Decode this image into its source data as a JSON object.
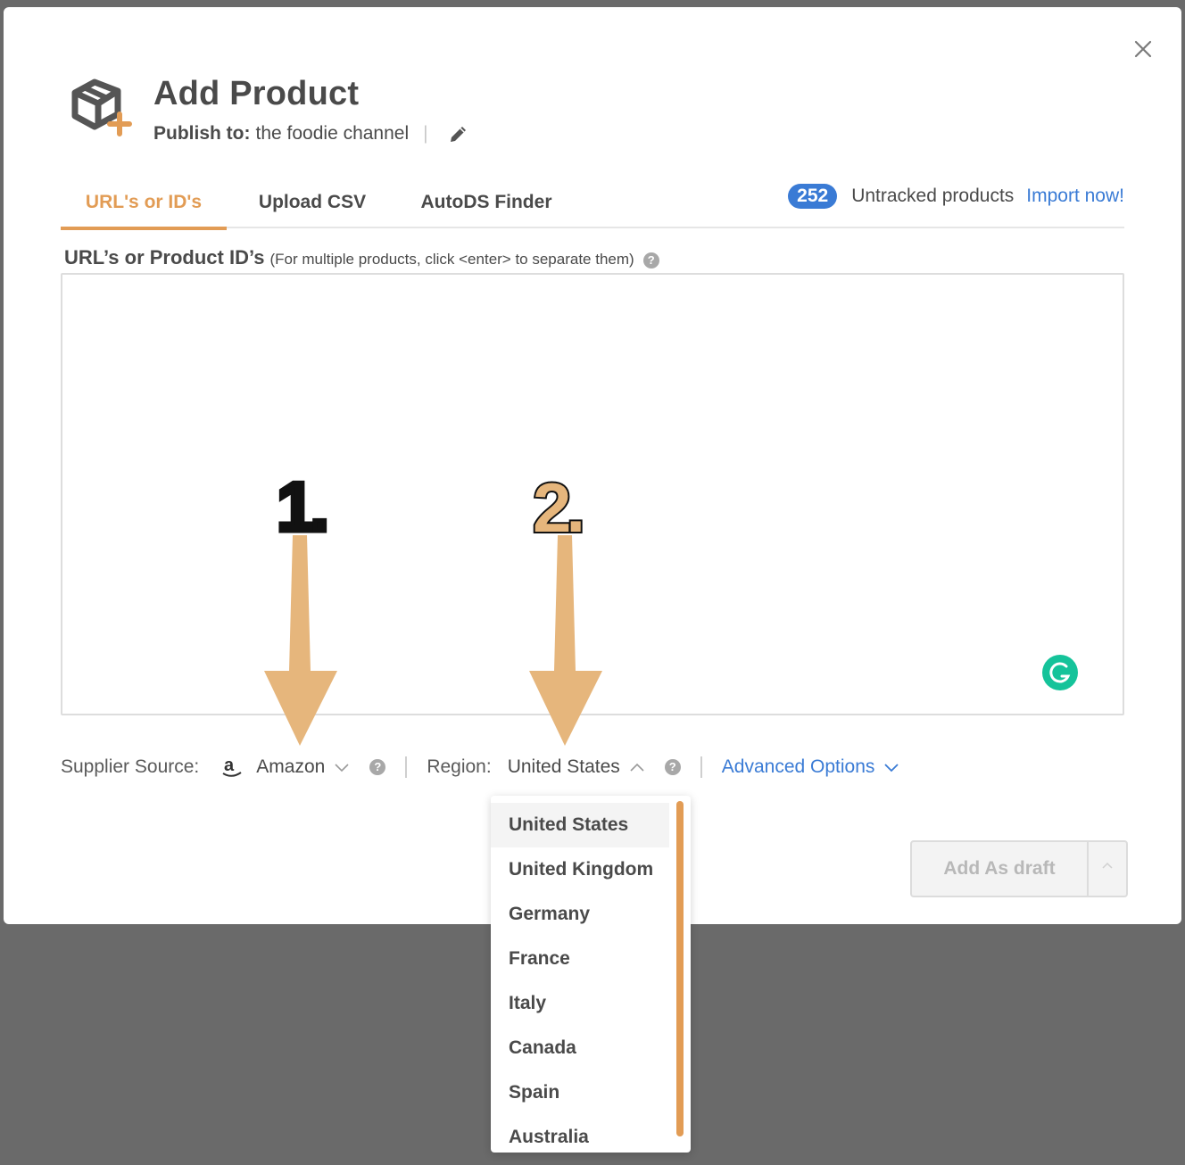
{
  "modal": {
    "title": "Add Product",
    "publish_prefix": "Publish to:",
    "publish_channel": "the foodie channel",
    "publish_separator": "|"
  },
  "tabs": [
    {
      "label": "URL's or ID's",
      "active": true
    },
    {
      "label": "Upload CSV",
      "active": false
    },
    {
      "label": "AutoDS Finder",
      "active": false
    }
  ],
  "untracked": {
    "count": "252",
    "label": "Untracked products",
    "link": "Import now!"
  },
  "field": {
    "label": "URL’s or Product ID’s",
    "hint": "(For multiple products, click <enter> to separate them)",
    "help": "?"
  },
  "options": {
    "supplier_label": "Supplier Source:",
    "supplier_value": "Amazon",
    "region_label": "Region:",
    "region_value": "United States",
    "advanced_label": "Advanced Options",
    "help": "?"
  },
  "region_dropdown": [
    "United States",
    "United Kingdom",
    "Germany",
    "France",
    "Italy",
    "Canada",
    "Spain",
    "Australia"
  ],
  "actions": {
    "add_draft": "Add As draft"
  },
  "annotations": {
    "step1": "1.",
    "step2": "2."
  },
  "colors": {
    "accent": "#e29c55",
    "link": "#3a7bd5",
    "text": "#4a4a4a",
    "overlay": "#6a6a6a",
    "grammarly": "#15c39a"
  },
  "icons": {
    "header": "box-plus-icon",
    "close": "close-icon",
    "edit": "pencil-icon",
    "supplier": "amazon-icon",
    "chevron": "chevron-down-icon"
  }
}
